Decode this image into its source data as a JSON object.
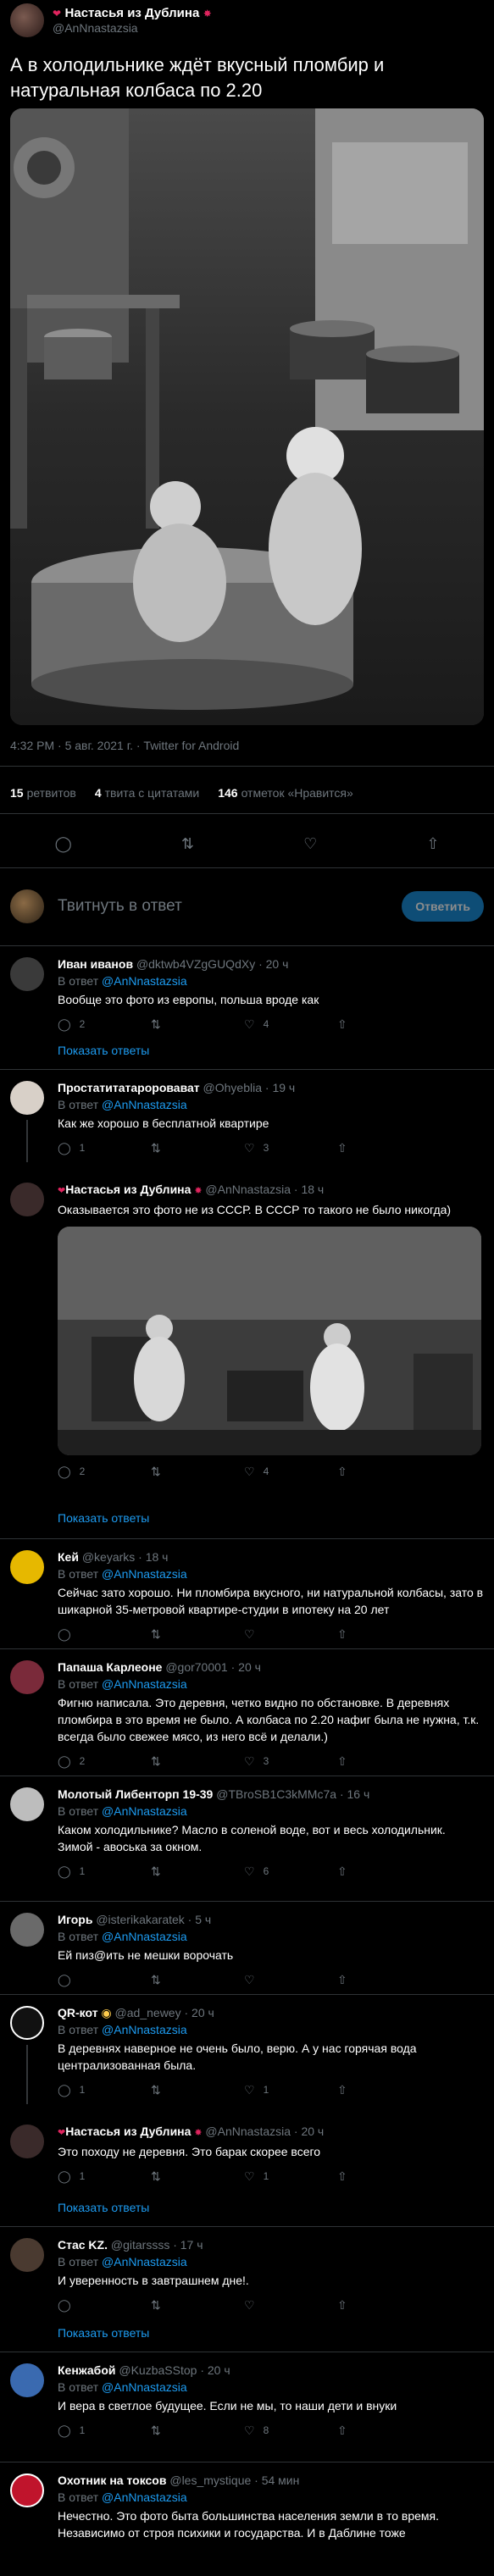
{
  "main": {
    "author_name": "Настасья из Дублина",
    "author_handle": "@AnNnastazsia",
    "text": "А в холодильнике ждёт вкусный пломбир и натуральная колбаса по 2.20",
    "meta": "4:32 PM · 5 авг. 2021 г. · Twitter for Android",
    "retweets_count": "15",
    "retweets_label": "ретвитов",
    "quotes_count": "4",
    "quotes_label": "твита с цитатами",
    "likes_count": "146",
    "likes_label": "отметок «Нравится»"
  },
  "reply_box": {
    "placeholder": "Твитнуть в ответ",
    "button": "Ответить"
  },
  "common": {
    "in_reply_to": "В ответ",
    "show_replies": "Показать ответы"
  },
  "replies": [
    {
      "name": "Иван иванов",
      "handle": "@dktwb4VZgGUQdXy",
      "time": "· 20 ч",
      "to": "@AnNnastazsia",
      "text": "Вообще это фото из европы, польша вроде как",
      "replies": "2",
      "likes": "4",
      "retweets": ""
    },
    {
      "name": "Простатитатароровават",
      "handle": "@Ohyeblia",
      "time": "· 19 ч",
      "to": "@AnNnastazsia",
      "text": "Как же хорошо в бесплатной квартире",
      "replies": "1",
      "likes": "3",
      "retweets": ""
    },
    {
      "name": "Настасья из Дублина",
      "handle": "@AnNnastazsia",
      "time": "· 18 ч",
      "to": "",
      "text": "Оказывается это фото не из СССР. В СССР то такого не было никогда)",
      "replies": "2",
      "likes": "4",
      "retweets": ""
    },
    {
      "name": "Кей",
      "handle": "@keyarks",
      "time": "· 18 ч",
      "to": "@AnNnastazsia",
      "text": "Сейчас зато хорошо. Ни пломбира вкусного, ни натуральной колбасы, зато в шикарной 35-метровой квартире-студии в ипотеку на 20 лет",
      "replies": "",
      "likes": "",
      "retweets": ""
    },
    {
      "name": "Папаша Карлеоне",
      "handle": "@gor70001",
      "time": "· 20 ч",
      "to": "@AnNnastazsia",
      "text": "Фигню написала. Это деревня, четко видно по обстановке. В деревнях пломбира в это время не было. А колбаса по 2.20 нафиг была не нужна, т.к. всегда было свежее мясо, из него всё и делали.)",
      "replies": "2",
      "likes": "3",
      "retweets": ""
    },
    {
      "name": "Молотый Либенторп 19-39",
      "handle": "@TBroSB1C3kMMc7a",
      "time": "· 16 ч",
      "to": "@AnNnastazsia",
      "text": "Каком холодильнике? Масло в соленой воде, вот и весь холодильник. Зимой - авоська за окном.",
      "replies": "1",
      "likes": "6",
      "retweets": ""
    },
    {
      "name": "Игорь",
      "handle": "@isterikakaratek",
      "time": "· 5 ч",
      "to": "@AnNnastazsia",
      "text": "Ей пиз@ить не мешки ворочать",
      "replies": "",
      "likes": "",
      "retweets": ""
    },
    {
      "name": "QR-кот",
      "handle": "@ad_newey",
      "time": "· 20 ч",
      "to": "@AnNnastazsia",
      "text": "В деревнях наверное не очень было, верю. А у нас горячая вода централизованная была.",
      "replies": "1",
      "likes": "1",
      "retweets": ""
    },
    {
      "name": "Настасья из Дублина",
      "handle": "@AnNnastazsia",
      "time": "· 20 ч",
      "to": "",
      "text": "Это походу не деревня. Это барак скорее всего",
      "replies": "1",
      "likes": "1",
      "retweets": ""
    },
    {
      "name": "Стас KZ.",
      "handle": "@gitarssss",
      "time": "· 17 ч",
      "to": "@AnNnastazsia",
      "text": "И уверенность в завтрашнем дне!.",
      "replies": "",
      "likes": "",
      "retweets": ""
    },
    {
      "name": "Кенжабой",
      "handle": "@KuzbaSStop",
      "time": "· 20 ч",
      "to": "@AnNnastazsia",
      "text": "И вера в светлое будущее. Если не мы, то наши дети и внуки",
      "replies": "1",
      "likes": "8",
      "retweets": ""
    },
    {
      "name": "Охотник на токсов",
      "handle": "@les_mystique",
      "time": "· 54 мин",
      "to": "@AnNnastazsia",
      "text": "Нечестно. Это фото быта большинства населения земли в то время. Независимо от строя психики и государства. И в Даблине тоже",
      "replies": "",
      "likes": "",
      "retweets": ""
    }
  ]
}
